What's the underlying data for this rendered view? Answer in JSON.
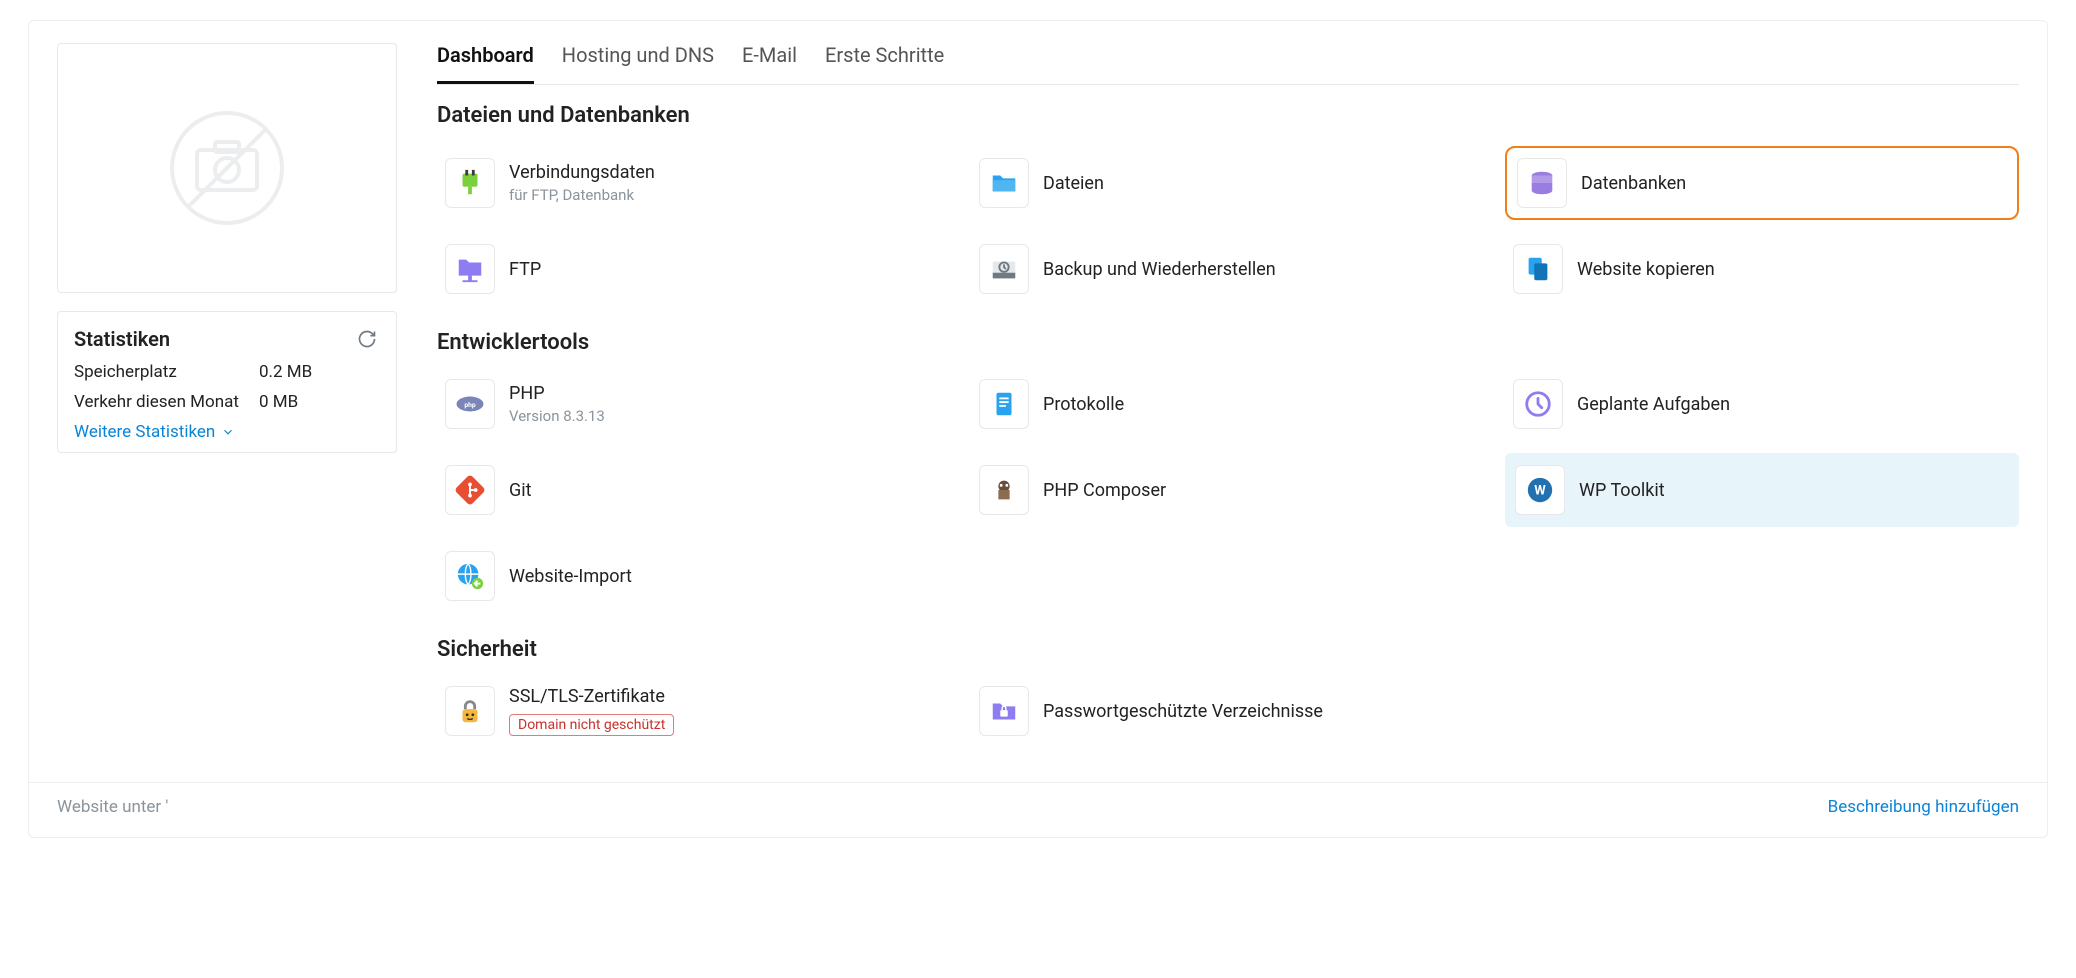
{
  "tabs": {
    "dashboard": "Dashboard",
    "hosting": "Hosting und DNS",
    "email": "E-Mail",
    "first_steps": "Erste Schritte"
  },
  "sidebar": {
    "stats_title": "Statistiken",
    "disk_label": "Speicherplatz",
    "disk_value": "0.2 MB",
    "traffic_label": "Verkehr diesen Monat",
    "traffic_value": "0 MB",
    "more_stats": "Weitere Statistiken"
  },
  "sections": {
    "files_db": "Dateien und Datenbanken",
    "dev_tools": "Entwicklertools",
    "security": "Sicherheit"
  },
  "tiles": {
    "conn_info": {
      "label": "Verbindungsdaten",
      "sub": "für FTP, Datenbank"
    },
    "files": {
      "label": "Dateien"
    },
    "databases": {
      "label": "Datenbanken"
    },
    "ftp": {
      "label": "FTP"
    },
    "backup": {
      "label": "Backup und Wiederherstellen"
    },
    "copy_site": {
      "label": "Website kopieren"
    },
    "php": {
      "label": "PHP",
      "sub": "Version 8.3.13"
    },
    "logs": {
      "label": "Protokolle"
    },
    "scheduled": {
      "label": "Geplante Aufgaben"
    },
    "git": {
      "label": "Git"
    },
    "composer": {
      "label": "PHP Composer"
    },
    "wp": {
      "label": "WP Toolkit"
    },
    "site_import": {
      "label": "Website-Import"
    },
    "ssl": {
      "label": "SSL/TLS-Zertifikate",
      "warn": "Domain nicht geschützt"
    },
    "pwdirs": {
      "label": "Passwortgeschützte Verzeichnisse"
    }
  },
  "footer": {
    "left": "Website unter '",
    "right": "Beschreibung hinzufügen"
  }
}
